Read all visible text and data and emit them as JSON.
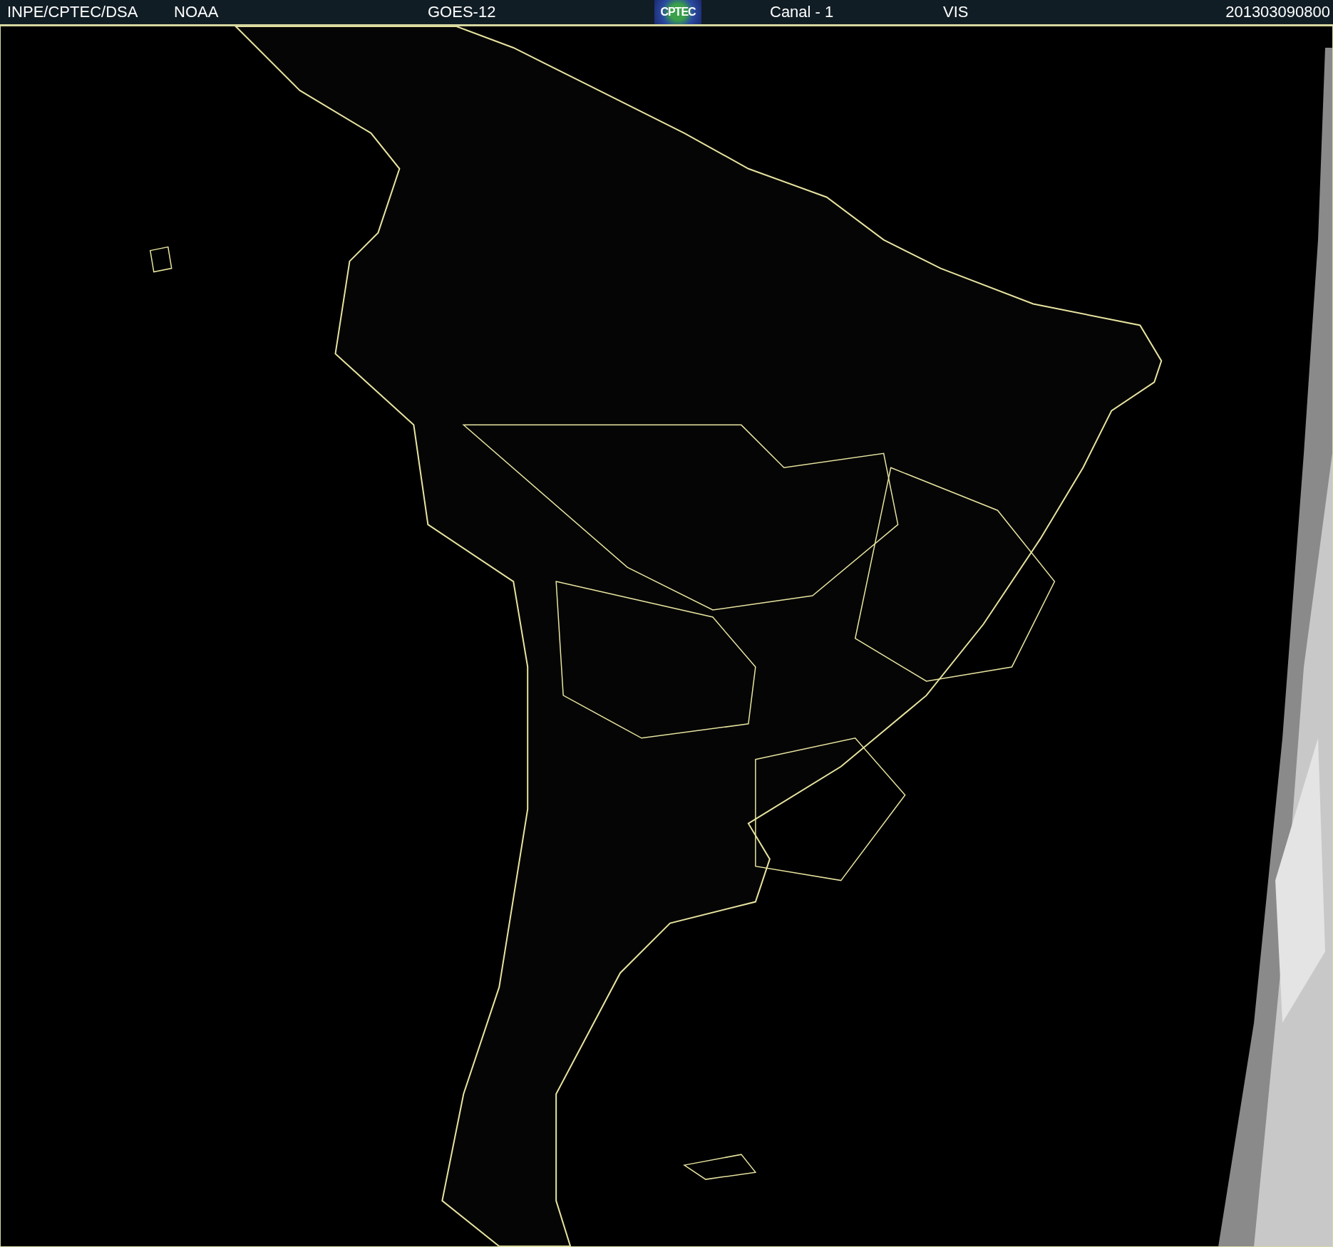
{
  "header": {
    "items": [
      {
        "kind": "text",
        "text": "INPE/CPTEC/DSA"
      },
      {
        "kind": "text",
        "text": "NOAA"
      },
      {
        "kind": "text",
        "text": "GOES-12"
      },
      {
        "kind": "logo",
        "text": "CPTEC"
      },
      {
        "kind": "text",
        "text": "Canal - 1"
      },
      {
        "kind": "text",
        "text": "VIS"
      },
      {
        "kind": "text",
        "text": "201303090800"
      }
    ]
  }
}
